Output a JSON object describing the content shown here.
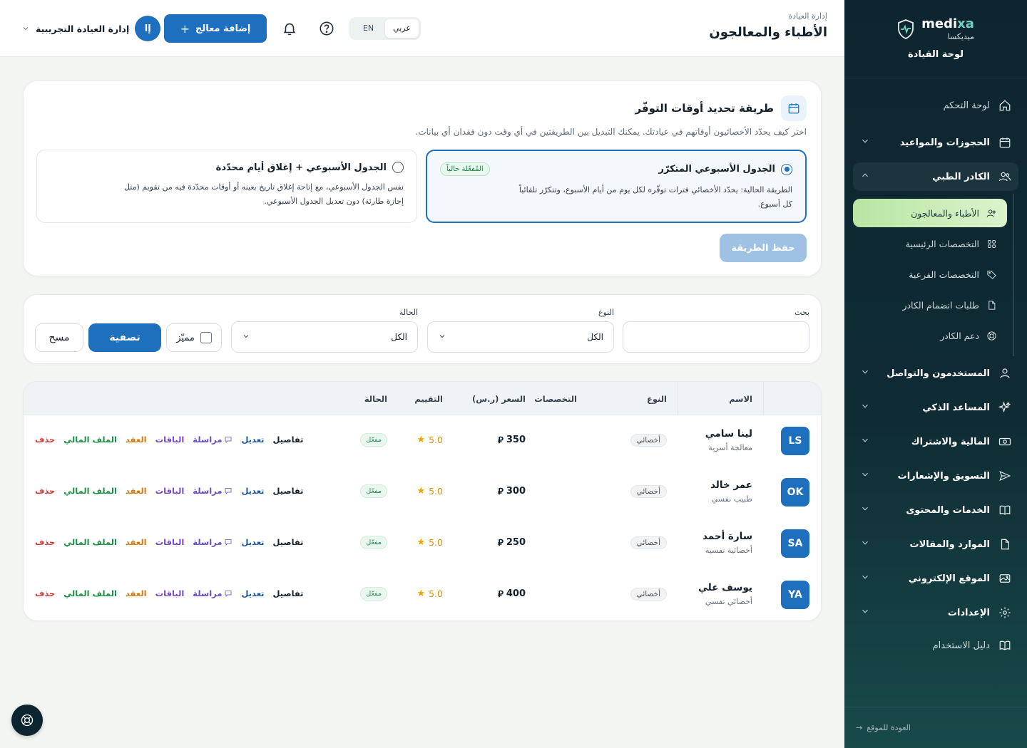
{
  "brand": {
    "name_en_prefix": "medi",
    "name_en_suffix": "xa",
    "name_ar": "ميديكسا",
    "subtitle": "لوحة القيادة"
  },
  "sidebar": {
    "items": [
      {
        "label": "لوحة التحكم",
        "icon": "home-icon"
      },
      {
        "label": "الحجوزات والمواعيد",
        "icon": "calendar-icon"
      },
      {
        "label": "الكادر الطبي",
        "icon": "users-icon"
      },
      {
        "label": "المستخدمون والتواصل",
        "icon": "user-icon"
      },
      {
        "label": "المساعد الذكي",
        "icon": "sparkles-icon"
      },
      {
        "label": "المالية والاشتراك",
        "icon": "money-icon"
      },
      {
        "label": "التسويق والإشعارات",
        "icon": "send-icon"
      },
      {
        "label": "الخدمات والمحتوى",
        "icon": "book-icon"
      },
      {
        "label": "الموارد والمقالات",
        "icon": "file-icon"
      },
      {
        "label": "الموقع الإلكتروني",
        "icon": "image-icon"
      },
      {
        "label": "الإعدادات",
        "icon": "gear-icon"
      },
      {
        "label": "دليل الاستخدام",
        "icon": "book-open-icon"
      }
    ],
    "sub_items": [
      {
        "label": "الأطباء والمعالجون",
        "icon": "users-icon"
      },
      {
        "label": "التخصصات الرئيسية",
        "icon": "grid-icon"
      },
      {
        "label": "التخصصات الفرعية",
        "icon": "tag-icon"
      },
      {
        "label": "طلبات انضمام الكادر",
        "icon": "file-icon"
      },
      {
        "label": "دعم الكادر",
        "icon": "lifebuoy-icon"
      }
    ],
    "back_label": "العودة للموقع"
  },
  "header": {
    "breadcrumb": "إدارة العيادة",
    "title": "الأطباء والمعالجون",
    "lang_ar": "عربي",
    "lang_en": "EN",
    "add_button": "إضافة معالج",
    "user_name": "إدارة العيادة التجريبية",
    "avatar_text": "إا"
  },
  "availability": {
    "title": "طريقة تحديد أوقات التوفّر",
    "description": "اختر كيف يحدّد الأخصائيون أوقاتهم في عيادتك. يمكنك التبديل بين الطريقتين في أي وقت دون فقدان أي بيانات.",
    "option1": {
      "title": "الجدول الأسبوعي المتكرّر",
      "badge": "المُفعّلة حالياً",
      "text_line1": "الطريقة الحالية: يحدّد الأخصائي فترات توفّره لكل يوم من أيام الأسبوع، وتتكرّر تلقائياً",
      "text_line2": "كل أسبوع."
    },
    "option2": {
      "title": "الجدول الأسبوعي + إغلاق أيام محدّدة",
      "text_line1": "نفس الجدول الأسبوعي، مع إتاحة إغلاق تاريخ بعينه أو أوقات محدّدة فيه من تقويم (مثل",
      "text_line2": "إجازة طارئة) دون تعديل الجدول الأسبوعي."
    },
    "save_button": "حفظ الطريقة"
  },
  "filters": {
    "search_label": "بحث",
    "search_value": "",
    "type_label": "النوع",
    "type_value": "الكل",
    "status_label": "الحالة",
    "status_value": "الكل",
    "featured_label": "مميّز",
    "filter_button": "تصفية",
    "clear_button": "مسح"
  },
  "table": {
    "headers": {
      "name": "الاسم",
      "type": "النوع",
      "specialties": "التخصصات",
      "price": "السعر (ر.س)",
      "rating": "التقييم",
      "status": "الحالة"
    },
    "actions": {
      "details": "تفاصيل",
      "edit": "تعديل",
      "message": "مراسلة",
      "packages": "الباقات",
      "contract": "العقد",
      "finance": "الملف المالي",
      "delete": "حذف"
    },
    "rows": [
      {
        "initials": "LS",
        "name": "لينا سامي",
        "role": "معالجة أسرية",
        "type": "أخصائي",
        "price": "350",
        "rating": "5.0",
        "status": "مفعّل"
      },
      {
        "initials": "OK",
        "name": "عمر خالد",
        "role": "طبيب نفسي",
        "type": "أخصائي",
        "price": "300",
        "rating": "5.0",
        "status": "مفعّل"
      },
      {
        "initials": "SA",
        "name": "سارة أحمد",
        "role": "أخصائية نفسية",
        "type": "أخصائي",
        "price": "250",
        "rating": "5.0",
        "status": "مفعّل"
      },
      {
        "initials": "YA",
        "name": "يوسف علي",
        "role": "أخصائي نفسي",
        "type": "أخصائي",
        "price": "400",
        "rating": "5.0",
        "status": "مفعّل"
      }
    ]
  },
  "colors": {
    "primary": "#1e6fbd",
    "sidebar": "#0d2530",
    "active_sub": "#b6e6a2"
  }
}
